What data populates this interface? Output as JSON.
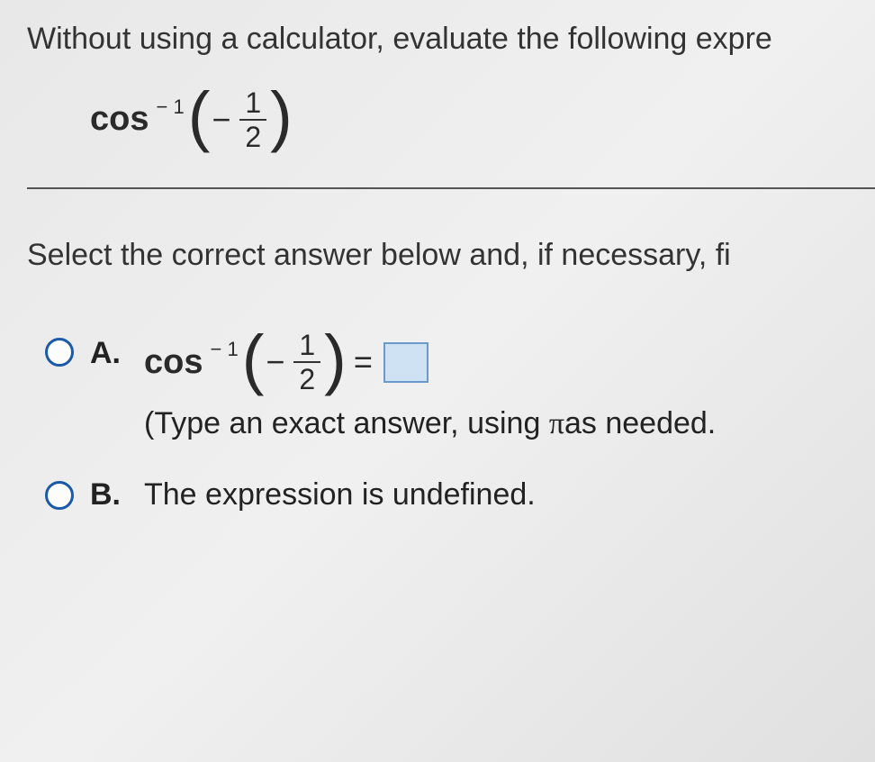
{
  "question": {
    "text": "Without using a calculator, evaluate the following expre"
  },
  "expression": {
    "func": "cos",
    "exp": "− 1",
    "argMinus": "−",
    "fracNum": "1",
    "fracDen": "2"
  },
  "prompt": "Select the correct answer below and, if necessary, fi",
  "options": {
    "a": {
      "label": "A.",
      "func": "cos",
      "exp": "− 1",
      "argMinus": "−",
      "fracNum": "1",
      "fracDen": "2",
      "equals": "=",
      "hint_prefix": "(Type an exact answer, using ",
      "pi": "π",
      "hint_suffix": "as needed."
    },
    "b": {
      "label": "B.",
      "text": "The expression is undefined."
    }
  }
}
